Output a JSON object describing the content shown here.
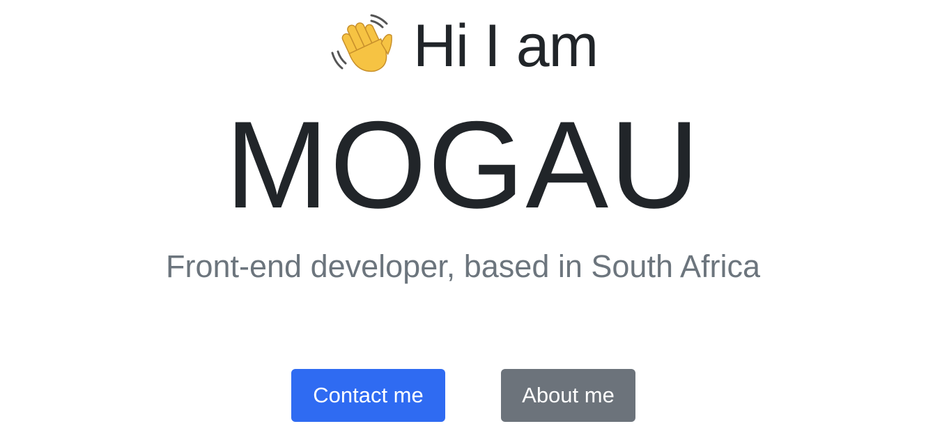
{
  "hero": {
    "greeting_icon": "waving-hand-icon",
    "greeting": "Hi I am",
    "name": "MOGAU",
    "tagline": "Front-end developer, based in South Africa"
  },
  "actions": {
    "contact_label": "Contact me",
    "about_label": "About me"
  },
  "colors": {
    "text": "#212529",
    "muted": "#6c757d",
    "primary": "#2f6bf2",
    "secondary": "#6c737b",
    "background": "#ffffff"
  }
}
